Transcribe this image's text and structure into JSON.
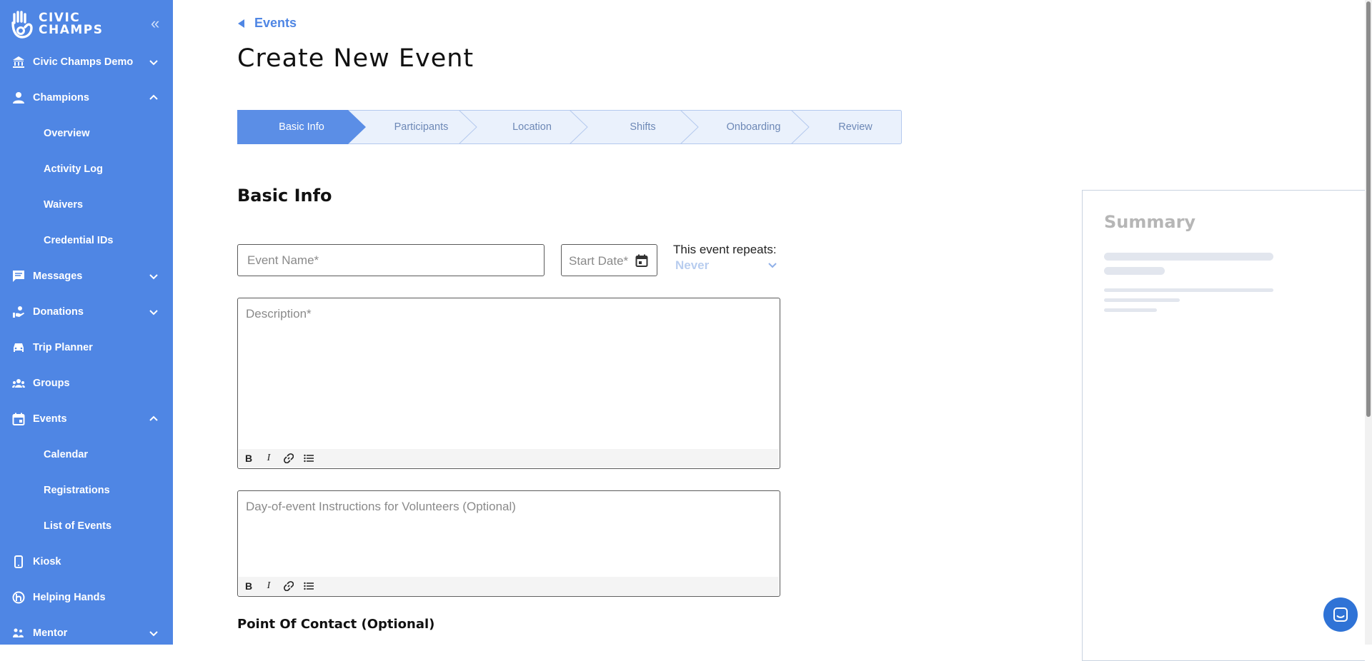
{
  "brand": {
    "line1": "CIVIC",
    "line2": "CHAMPS"
  },
  "sidebar": {
    "items": [
      {
        "label": "Civic Champs Demo",
        "icon": "bank-icon",
        "chevron": "down"
      },
      {
        "label": "Champions",
        "icon": "person-icon",
        "chevron": "up"
      },
      {
        "label": "Overview"
      },
      {
        "label": "Activity Log"
      },
      {
        "label": "Waivers"
      },
      {
        "label": "Credential IDs"
      },
      {
        "label": "Messages",
        "icon": "message-icon",
        "chevron": "down"
      },
      {
        "label": "Donations",
        "icon": "donation-icon",
        "chevron": "down"
      },
      {
        "label": "Trip Planner",
        "icon": "car-icon"
      },
      {
        "label": "Groups",
        "icon": "groups-icon"
      },
      {
        "label": "Events",
        "icon": "calendar-icon",
        "chevron": "up"
      },
      {
        "label": "Calendar"
      },
      {
        "label": "Registrations"
      },
      {
        "label": "List of Events"
      },
      {
        "label": "Kiosk",
        "icon": "phone-icon"
      },
      {
        "label": "Helping Hands",
        "icon": "helping-hands-icon"
      },
      {
        "label": "Mentor",
        "icon": "mentor-icon",
        "chevron": "down"
      }
    ]
  },
  "breadcrumb": {
    "back_label": "Events"
  },
  "page": {
    "title": "Create New Event"
  },
  "stepper": {
    "steps": [
      "Basic Info",
      "Participants",
      "Location",
      "Shifts",
      "Onboarding",
      "Review"
    ],
    "active_index": 0
  },
  "form": {
    "section_title": "Basic Info",
    "event_name_placeholder": "Event Name*",
    "start_date_placeholder": "Start Date*",
    "repeat_label": "This event repeats:",
    "repeat_value": "Never",
    "description_placeholder": "Description*",
    "instructions_placeholder": "Day-of-event Instructions for Volunteers (Optional)",
    "point_of_contact_title": "Point Of Contact (Optional)"
  },
  "summary": {
    "title": "Summary"
  },
  "colors": {
    "accent": "#4f86e4",
    "stepper_bg": "#eaf1fc",
    "stepper_border": "#b4c9ee",
    "repeat_value": "#b8cdef"
  }
}
